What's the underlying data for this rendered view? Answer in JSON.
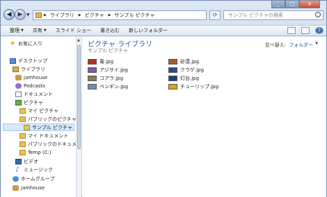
{
  "address": {
    "parts": [
      "ライブラリ",
      "ピクチャ",
      "サンプル ピクチャ"
    ]
  },
  "search": {
    "placeholder": "サンプル ピクチャの検索"
  },
  "toolbar": {
    "organize": "整理",
    "share": "共有",
    "slideshow": "スライド ショー",
    "burn": "書き込む",
    "new_folder": "新しいフォルダー",
    "help": "?"
  },
  "sidebar": {
    "favorites": "お気に入り",
    "desktop": "デスクトップ",
    "libraries": "ライブラリ",
    "jamhouse1": "jamhouse",
    "podcasts": "Podcasts",
    "documents": "ドキュメント",
    "pictures": "ピクチャ",
    "my_pictures": "マイ ピクチャ",
    "public_pictures": "パブリックのピクチャ",
    "sample_pictures": "サンプル ピクチャ",
    "my_documents": "マイ ドキュメント",
    "public_documents": "パブリックのドキュメン",
    "temp": "Temp (C:)",
    "video": "ビデオ",
    "music": "ミュージック",
    "homegroup": "ホームグループ",
    "jamhouse2": "jamhouse"
  },
  "content": {
    "title": "ピクチャ ライブラリ",
    "subtitle": "サンプル ピクチャ",
    "arrange_label": "並べ替え:",
    "arrange_value": "フォルダー",
    "files_left": [
      "菊.jpg",
      "アジサイ.jpg",
      "コアラ.jpg",
      "ペンギン.jpg"
    ],
    "files_right": [
      "砂漠.jpg",
      "クラゲ.jpg",
      "灯台.jpg",
      "チューリップ.jpg"
    ],
    "thumb_colors_left": [
      "#b0361c",
      "#7f5aa8",
      "#8a7a5a",
      "#6f8fb5"
    ],
    "thumb_colors_right": [
      "#a55a2a",
      "#2a4f6f",
      "#1f3f7f",
      "#d4a520"
    ]
  }
}
